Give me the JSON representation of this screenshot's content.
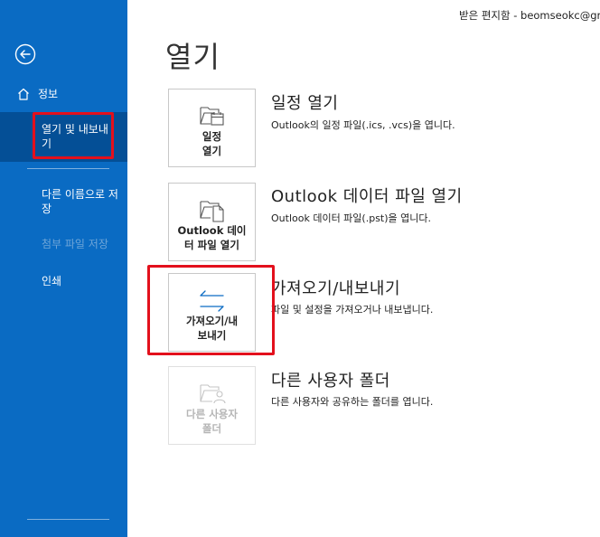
{
  "topbar": {
    "text": "받은 편지함 - beomseokc@gm"
  },
  "sidebar": {
    "back_icon": "back-arrow-icon",
    "info": {
      "icon": "home-icon",
      "label": "정보"
    },
    "open_export": {
      "label": "열기 및 내보내기"
    },
    "save_as": {
      "label": "다른 이름으로 저장"
    },
    "save_attachments": {
      "label": "첨부 파일 저장"
    },
    "print": {
      "label": "인쇄"
    }
  },
  "main": {
    "title": "열기",
    "options": [
      {
        "tile_label": "일정\n열기",
        "icon": "open-calendar-icon",
        "title": "일정 열기",
        "desc": "Outlook의 일정 파일(.ics, .vcs)을 엽니다."
      },
      {
        "tile_label": "Outlook 데이\n터 파일 열기",
        "icon": "open-data-file-icon",
        "title": "Outlook 데이터 파일 열기",
        "desc": "Outlook 데이터 파일(.pst)을 엽니다."
      },
      {
        "tile_label": "가져오기/내\n보내기",
        "icon": "import-export-icon",
        "title": "가져오기/내보내기",
        "desc": "파일 및 설정을 가져오거나 내보냅니다."
      },
      {
        "tile_label": "다른 사용자\n폴더",
        "icon": "other-user-folder-icon",
        "title": "다른 사용자 폴더",
        "desc": "다른 사용자와 공유하는 폴더를 엽니다."
      }
    ]
  },
  "colors": {
    "sidebar": "#0a6bc3",
    "sidebar_selected": "#044f96",
    "highlight": "#e3101c"
  }
}
